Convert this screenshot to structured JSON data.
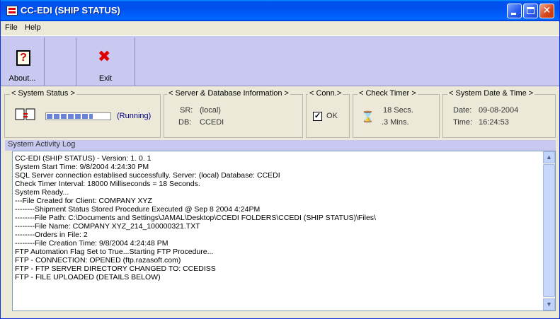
{
  "window": {
    "title": "CC-EDI (SHIP STATUS)"
  },
  "menu": [
    "File",
    "Help"
  ],
  "toolbar": {
    "about_label": "About...",
    "exit_label": "Exit"
  },
  "status": {
    "legend": "< System Status >",
    "state": "(Running)",
    "progress": 0.73
  },
  "server": {
    "legend": "< Server & Database Information >",
    "sr_label": "SR:",
    "sr_value": "(local)",
    "db_label": "DB:",
    "db_value": "CCEDI"
  },
  "conn": {
    "legend": "< Conn.>",
    "check": "✓",
    "value": "OK"
  },
  "timer": {
    "legend": "< Check Timer >",
    "secs": "18 Secs.",
    "mins": ".3 Mins."
  },
  "datetime": {
    "legend": "< System Date & Time >",
    "date_label": "Date:",
    "date_value": "09-08-2004",
    "time_label": "Time:",
    "time_value": "16:24:53"
  },
  "log": {
    "title": "System Activity Log",
    "lines": [
      "CC-EDI (SHIP STATUS) - Version: 1. 0. 1",
      "System Start Time:  9/8/2004 4:24:30 PM",
      "SQL Server connection establised successfully.  Server: (local)  Database: CCEDI",
      "Check Timer Interval:  18000 Milliseconds = 18 Seconds.",
      "System Ready...",
      "---File Created for Client:  COMPANY XYZ",
      "--------Shipment Status Stored Procedure Executed @ Sep  8 2004  4:24PM",
      "--------File Path:  C:\\Documents and Settings\\JAMAL\\Desktop\\CCEDI FOLDERS\\CCEDI (SHIP STATUS)\\Files\\",
      "--------File Name:  COMPANY XYZ_214_100000321.TXT",
      "--------Orders in File:  2",
      "--------File Creation Time:  9/8/2004 4:24:48 PM",
      "FTP Automation Flag Set to True...Starting FTP Procedure...",
      "FTP - CONNECTION:  OPENED (ftp.razasoft.com)",
      "FTP - FTP SERVER DIRECTORY CHANGED TO: CCEDISS",
      "FTP - FILE UPLOADED (DETAILS BELOW)"
    ]
  }
}
